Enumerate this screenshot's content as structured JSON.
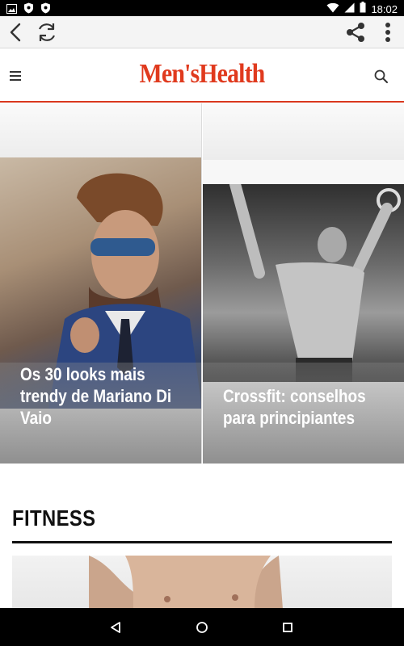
{
  "status_bar": {
    "time": "18:02",
    "left_icons": [
      "image-notification-icon",
      "shield-icon",
      "shield-icon"
    ],
    "right_icons": [
      "wifi-icon",
      "signal-icon",
      "battery-icon"
    ]
  },
  "browser_toolbar": {
    "buttons": [
      "back-icon",
      "refresh-icon",
      "share-icon",
      "overflow-menu-icon"
    ]
  },
  "header": {
    "logo_text": "Men'sHealth",
    "brand_color": "#e03a1e"
  },
  "cards": [
    {
      "title": "Os 30 looks mais trendy de Mariano Di Vaio"
    },
    {
      "title": "Crossfit: conselhos para principiantes"
    }
  ],
  "section": {
    "title": "FITNESS"
  },
  "nav_bar": {
    "buttons": [
      "back-triangle-icon",
      "home-circle-icon",
      "recents-square-icon"
    ]
  }
}
